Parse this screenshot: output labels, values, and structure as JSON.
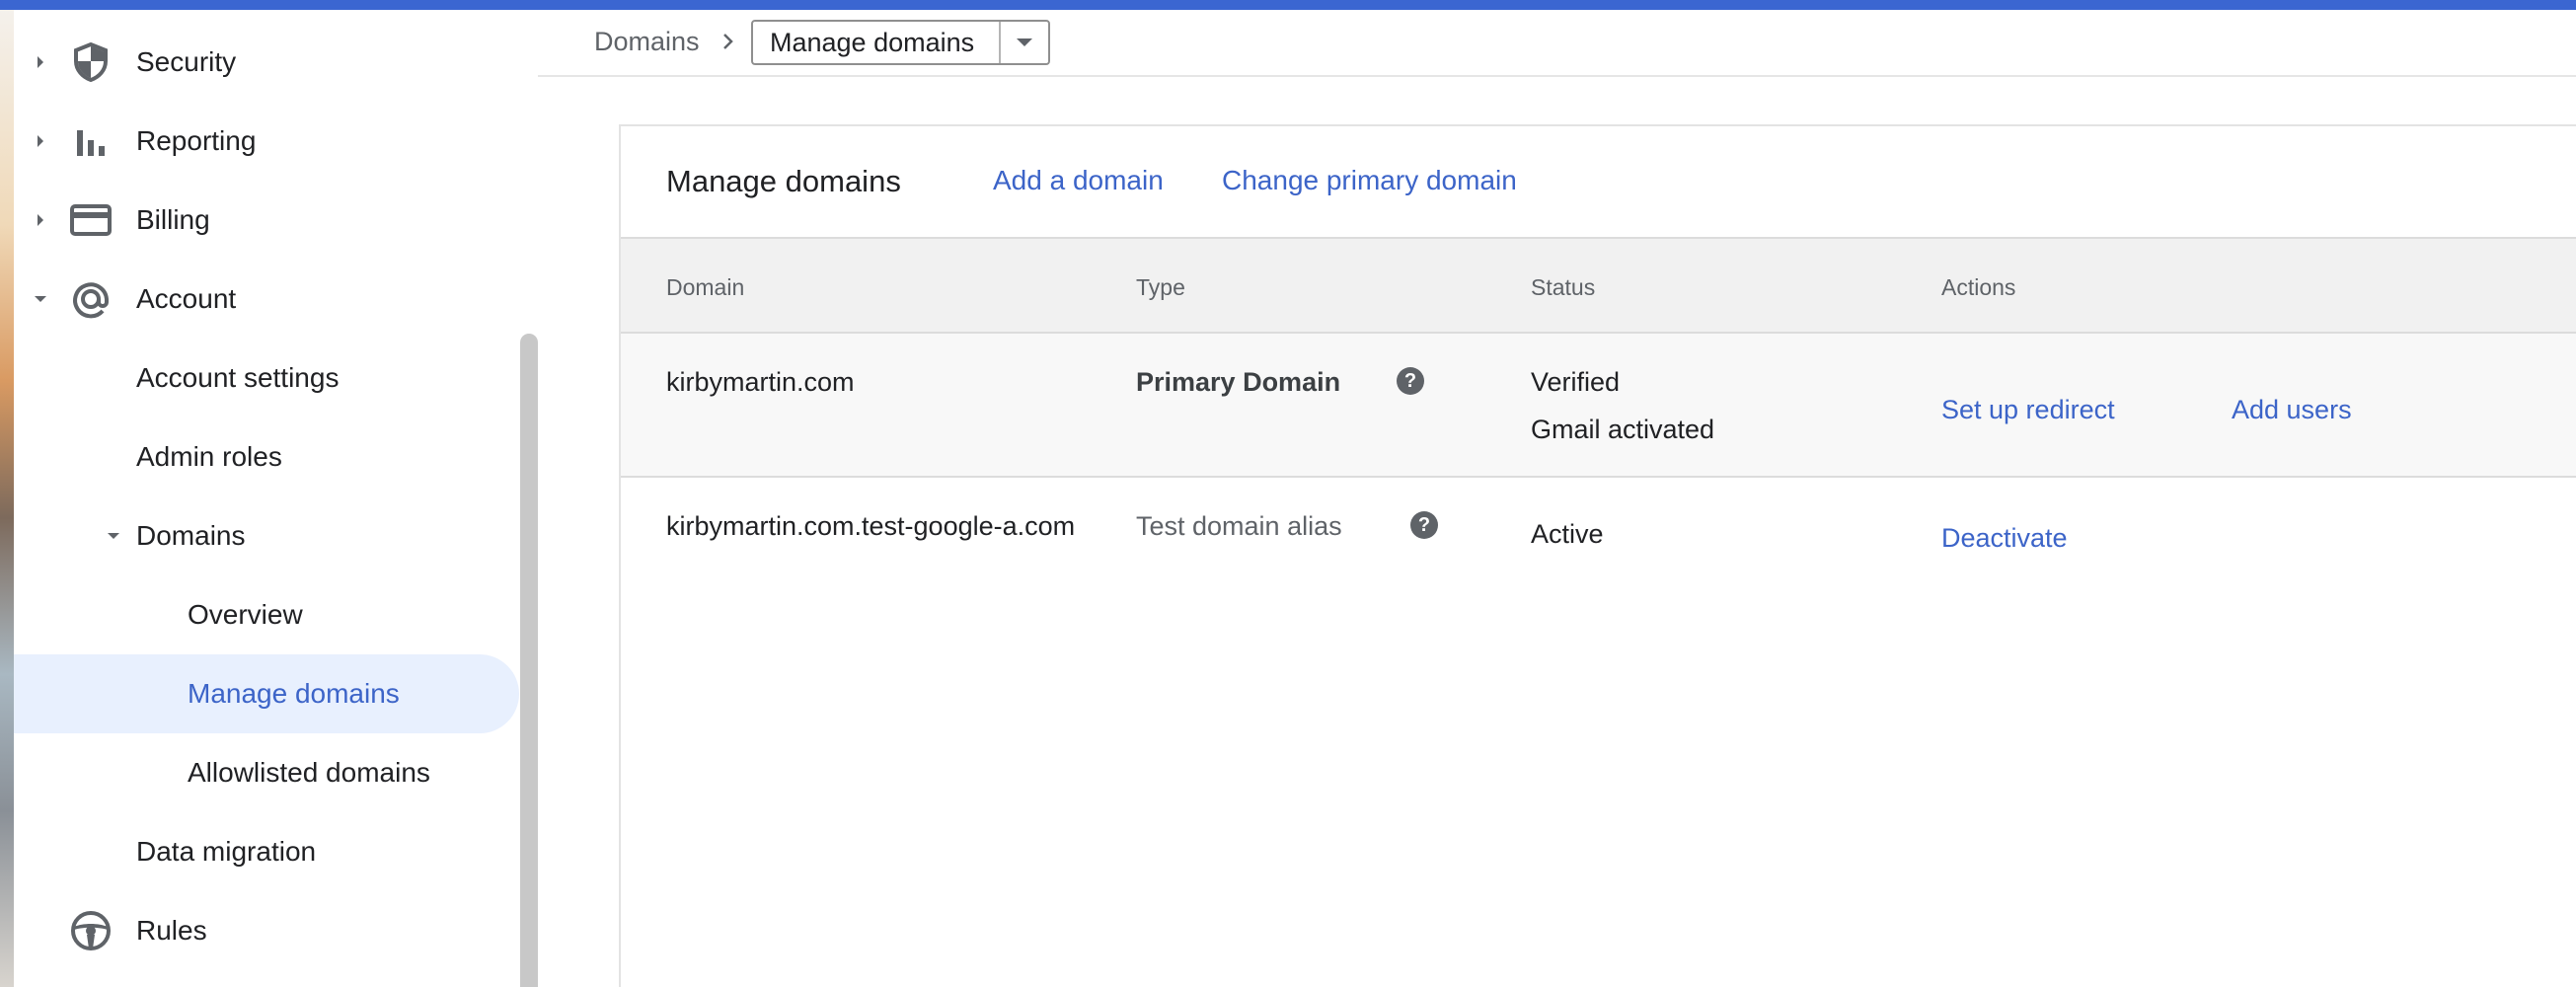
{
  "colors": {
    "accent": "#3b66d1",
    "link": "#3c64c8",
    "active_bg": "#e8f0fe"
  },
  "sidebar": {
    "items": [
      {
        "label": "Security",
        "icon": "shield-icon",
        "caret": "right"
      },
      {
        "label": "Reporting",
        "icon": "bar-chart-icon",
        "caret": "right"
      },
      {
        "label": "Billing",
        "icon": "credit-card-icon",
        "caret": "right"
      },
      {
        "label": "Account",
        "icon": "at-sign-icon",
        "caret": "down"
      },
      {
        "label": "Account settings"
      },
      {
        "label": "Admin roles"
      },
      {
        "label": "Domains",
        "caret": "down"
      },
      {
        "label": "Overview"
      },
      {
        "label": "Manage domains",
        "active": true
      },
      {
        "label": "Allowlisted domains"
      },
      {
        "label": "Data migration"
      },
      {
        "label": "Rules",
        "icon": "steering-wheel-icon"
      }
    ]
  },
  "breadcrumb": {
    "parent": "Domains",
    "current": "Manage domains"
  },
  "card": {
    "title": "Manage domains",
    "add_domain": "Add a domain",
    "change_primary": "Change primary domain"
  },
  "table": {
    "headers": {
      "domain": "Domain",
      "type": "Type",
      "status": "Status",
      "actions": "Actions"
    },
    "rows": [
      {
        "domain": "kirbymartin.com",
        "type": "Primary Domain",
        "status": [
          "Verified",
          "Gmail activated"
        ],
        "actions": [
          "Set up redirect",
          "Add users"
        ]
      },
      {
        "domain": "kirbymartin.com.test-google-a.com",
        "type": "Test domain alias",
        "status": [
          "Active"
        ],
        "actions": [
          "Deactivate"
        ]
      }
    ]
  }
}
